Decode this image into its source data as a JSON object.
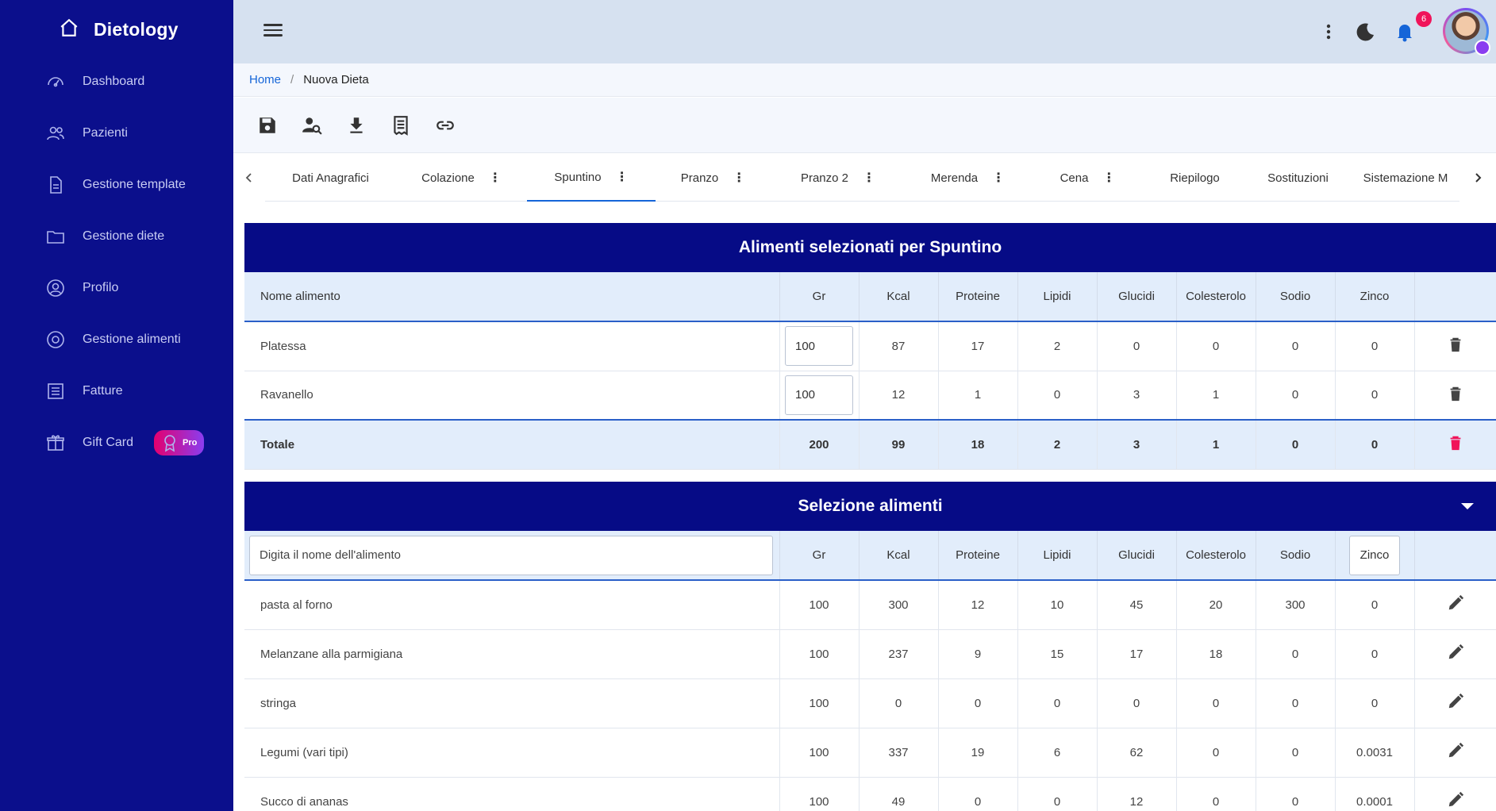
{
  "app": {
    "title": "Dietology"
  },
  "sidebar": {
    "items": [
      {
        "label": "Dashboard",
        "icon": "dashboard-icon"
      },
      {
        "label": "Pazienti",
        "icon": "users-icon"
      },
      {
        "label": "Gestione template",
        "icon": "document-icon"
      },
      {
        "label": "Gestione diete",
        "icon": "folder-icon"
      },
      {
        "label": "Profilo",
        "icon": "user-circle-icon"
      },
      {
        "label": "Gestione alimenti",
        "icon": "target-icon"
      },
      {
        "label": "Fatture",
        "icon": "invoice-icon"
      },
      {
        "label": "Gift Card",
        "icon": "gift-icon",
        "badge": "Pro"
      }
    ]
  },
  "topbar": {
    "notifications_count": "6"
  },
  "breadcrumb": {
    "home": "Home",
    "separator": "/",
    "current": "Nuova Dieta"
  },
  "toolbar": [
    "save-icon",
    "user-search-icon",
    "download-icon",
    "receipt-icon",
    "link-icon"
  ],
  "tabs": [
    {
      "label": "Dati Anagrafici",
      "menu": false
    },
    {
      "label": "Colazione",
      "menu": true
    },
    {
      "label": "Spuntino",
      "menu": true,
      "active": true
    },
    {
      "label": "Pranzo",
      "menu": true
    },
    {
      "label": "Pranzo 2",
      "menu": true
    },
    {
      "label": "Merenda",
      "menu": true
    },
    {
      "label": "Cena",
      "menu": true
    },
    {
      "label": "Riepilogo",
      "menu": false
    },
    {
      "label": "Sostituzioni",
      "menu": false
    },
    {
      "label": "Sistemazione M",
      "menu": false
    }
  ],
  "selected": {
    "title": "Alimenti selezionati per Spuntino",
    "columns": [
      "Nome alimento",
      "Gr",
      "Kcal",
      "Proteine",
      "Lipidi",
      "Glucidi",
      "Colesterolo",
      "Sodio",
      "Zinco"
    ],
    "rows": [
      {
        "name": "Platessa",
        "gr": "100",
        "kcal": "87",
        "proteine": "17",
        "lipidi": "2",
        "glucidi": "0",
        "colesterolo": "0",
        "sodio": "0",
        "zinco": "0"
      },
      {
        "name": "Ravanello",
        "gr": "100",
        "kcal": "12",
        "proteine": "1",
        "lipidi": "0",
        "glucidi": "3",
        "colesterolo": "1",
        "sodio": "0",
        "zinco": "0"
      }
    ],
    "total": {
      "name": "Totale",
      "gr": "200",
      "kcal": "99",
      "proteine": "18",
      "lipidi": "2",
      "glucidi": "3",
      "colesterolo": "1",
      "sodio": "0",
      "zinco": "0"
    }
  },
  "selection": {
    "title": "Selezione alimenti",
    "search_placeholder": "Digita il nome dell'alimento",
    "columns": [
      "Gr",
      "Kcal",
      "Proteine",
      "Lipidi",
      "Glucidi",
      "Colesterolo",
      "Sodio",
      "Zinco"
    ],
    "rows": [
      {
        "name": "pasta al forno",
        "gr": "100",
        "kcal": "300",
        "proteine": "12",
        "lipidi": "10",
        "glucidi": "45",
        "colesterolo": "20",
        "sodio": "300",
        "zinco": "0"
      },
      {
        "name": "Melanzane alla parmigiana",
        "gr": "100",
        "kcal": "237",
        "proteine": "9",
        "lipidi": "15",
        "glucidi": "17",
        "colesterolo": "18",
        "sodio": "0",
        "zinco": "0"
      },
      {
        "name": "stringa",
        "gr": "100",
        "kcal": "0",
        "proteine": "0",
        "lipidi": "0",
        "glucidi": "0",
        "colesterolo": "0",
        "sodio": "0",
        "zinco": "0"
      },
      {
        "name": "Legumi (vari tipi)",
        "gr": "100",
        "kcal": "337",
        "proteine": "19",
        "lipidi": "6",
        "glucidi": "62",
        "colesterolo": "0",
        "sodio": "0",
        "zinco": "0.0031"
      },
      {
        "name": "Succo di ananas",
        "gr": "100",
        "kcal": "49",
        "proteine": "0",
        "lipidi": "0",
        "glucidi": "12",
        "colesterolo": "0",
        "sodio": "0",
        "zinco": "0.0001"
      }
    ]
  },
  "colors": {
    "sidebar": "#0b0f8c",
    "panel_header": "#060b86",
    "accent": "#1565d8",
    "danger": "#f0145a"
  }
}
